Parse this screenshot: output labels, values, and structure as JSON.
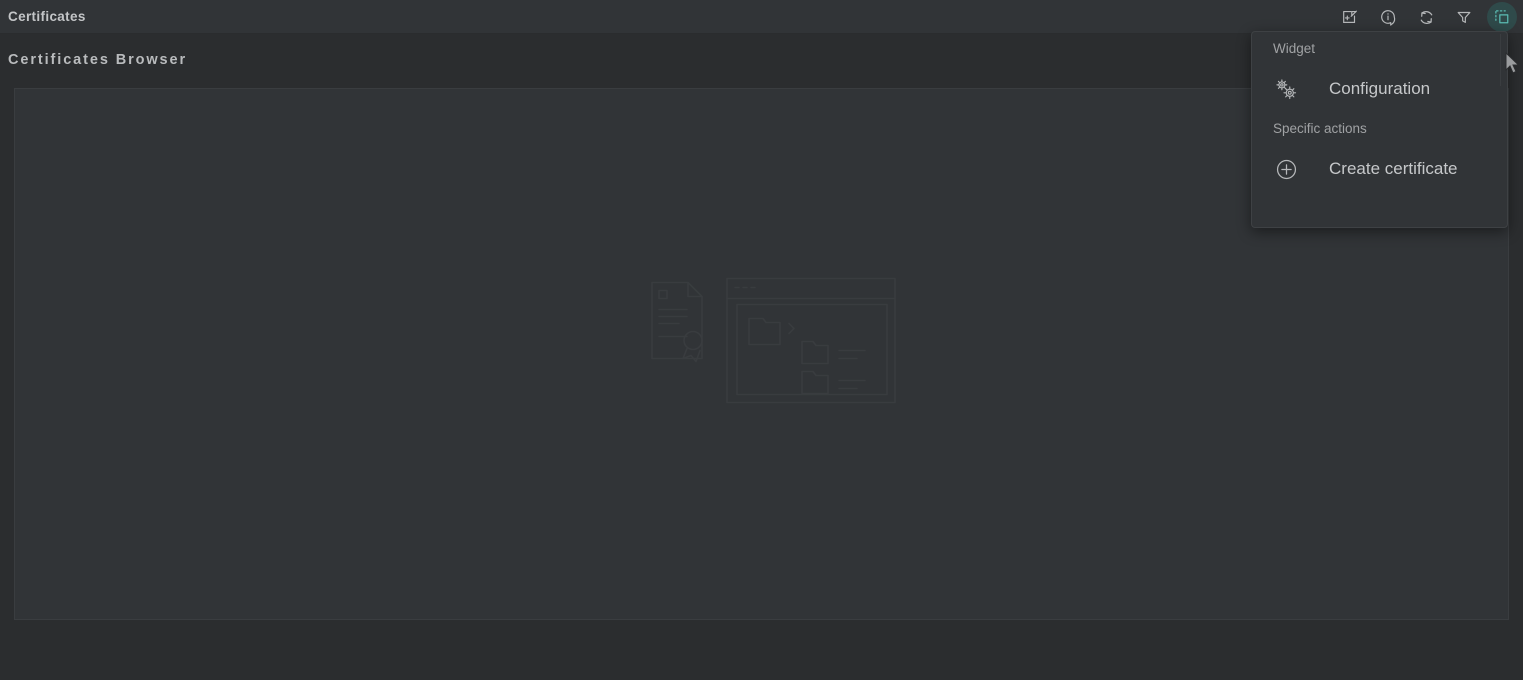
{
  "header": {
    "title": "Certificates",
    "tools": [
      {
        "name": "open-in-new-window-icon",
        "tooltip": "Open in new window"
      },
      {
        "name": "info-icon",
        "tooltip": "Information"
      },
      {
        "name": "refresh-icon",
        "tooltip": "Refresh"
      },
      {
        "name": "filter-icon",
        "tooltip": "Filter"
      },
      {
        "name": "widget-menu-icon",
        "tooltip": "Widget menu",
        "active": true
      }
    ]
  },
  "page": {
    "title": "Certificates Browser"
  },
  "content": {
    "watermark": "certificates-browser-placeholder"
  },
  "menu": {
    "sections": [
      {
        "label": "Widget",
        "items": [
          {
            "label": "Configuration",
            "icon": "gears-icon"
          }
        ]
      },
      {
        "label": "Specific actions",
        "items": [
          {
            "label": "Create certificate",
            "icon": "plus-circle-icon"
          }
        ]
      }
    ]
  },
  "colors": {
    "app_background": "#2b2d2f",
    "panel_background": "#313437",
    "panel_border": "#3a3d40",
    "text_primary": "#c6c8ca",
    "text_secondary": "#a0a2a4",
    "accent_teal": "#5bbdb4",
    "active_button_background": "#2f4a4a"
  }
}
